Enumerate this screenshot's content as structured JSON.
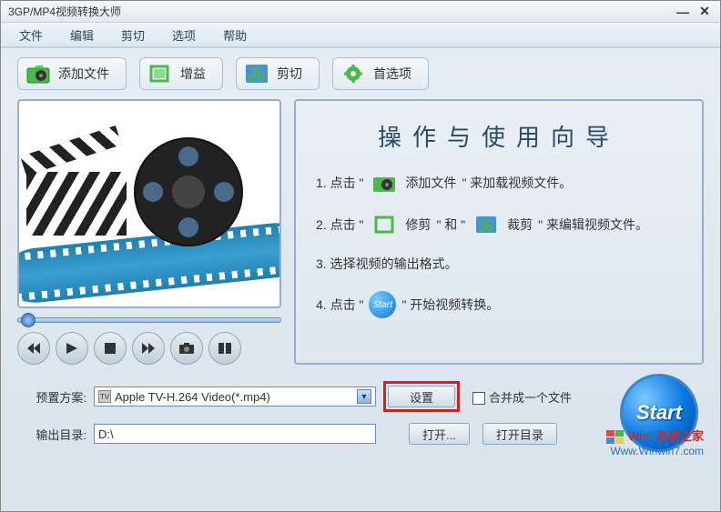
{
  "window": {
    "title": "3GP/MP4视频转换大师"
  },
  "menu": {
    "file": "文件",
    "edit": "编辑",
    "cut": "剪切",
    "options": "选项",
    "help": "帮助"
  },
  "toolbar": {
    "add_file": "添加文件",
    "gain": "增益",
    "cut": "剪切",
    "preferences": "首选项"
  },
  "guide": {
    "title": "操作与使用向导",
    "step1_prefix": "1. 点击 \"",
    "step1_label": "添加文件",
    "step1_suffix": "\" 来加载视频文件。",
    "step2_prefix": "2. 点击 \"",
    "step2_trim": "修剪",
    "step2_and": "\" 和 \"",
    "step2_crop": "裁剪",
    "step2_suffix": "\" 来编辑视频文件。",
    "step3": "3. 选择视频的输出格式。",
    "step4_prefix": "4. 点击 \"",
    "step4_suffix": "\" 开始视频转换。"
  },
  "bottom": {
    "preset_label": "预置方案:",
    "preset_value": "Apple TV-H.264 Video(*.mp4)",
    "settings": "设置",
    "merge": "合并成一个文件",
    "output_label": "输出目录:",
    "output_value": "D:\\",
    "open": "打开...",
    "open_dir": "打开目录",
    "start": "Start"
  },
  "watermark": {
    "line1a": "Win",
    "line1b": "7",
    "line1c": "系统之家",
    "line2": "Www.Winwin7.com"
  }
}
